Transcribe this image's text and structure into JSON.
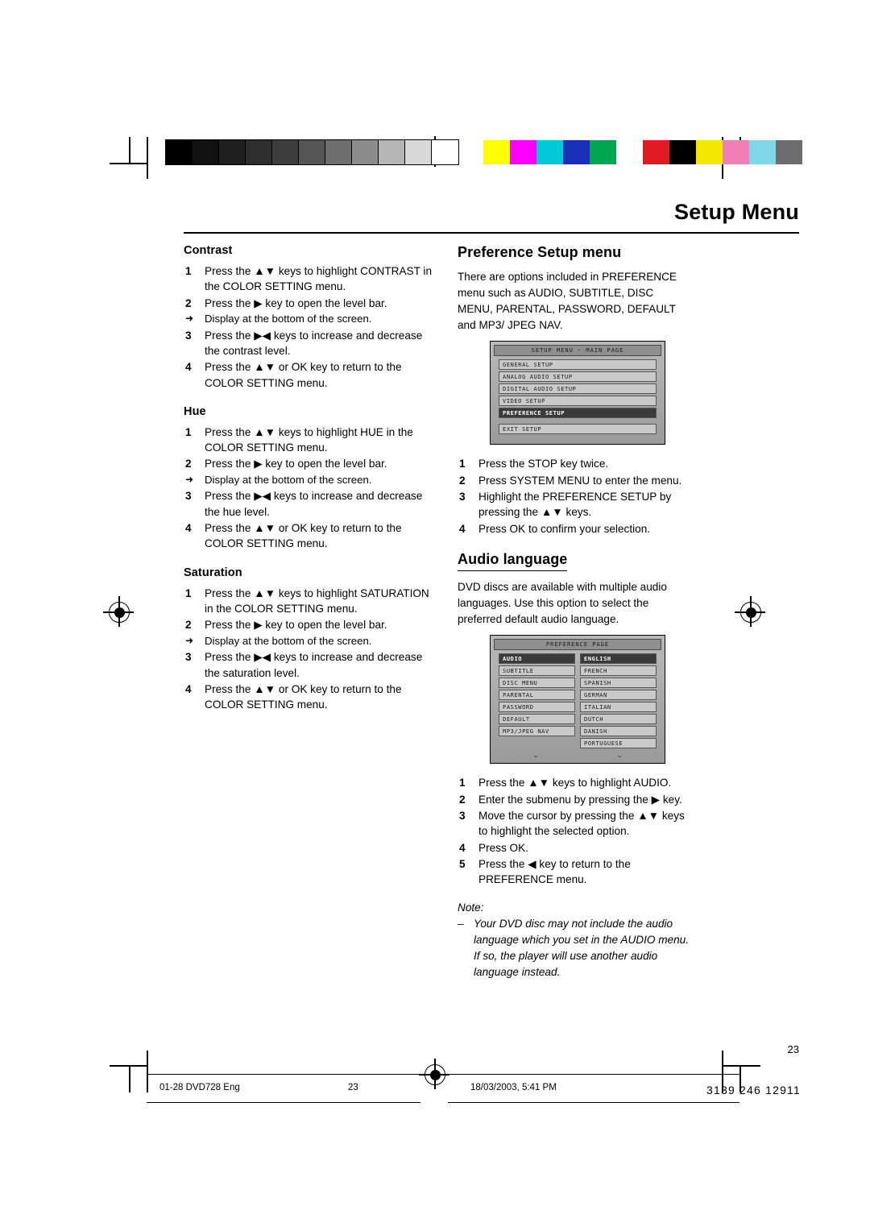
{
  "header": {
    "title": "Setup Menu"
  },
  "left_column": {
    "sections": [
      {
        "heading": "Contrast",
        "steps": [
          "Press the ▲▼ keys to highlight CONTRAST in the COLOR SETTING menu.",
          "Press the ▶ key to open the level bar.",
          "Press the ▶◀ keys to increase and decrease the contrast level.",
          "Press the ▲▼ or OK key to return to the COLOR SETTING menu."
        ],
        "note_after_step": 2,
        "note": "Display at the bottom of the screen."
      },
      {
        "heading": "Hue",
        "steps": [
          "Press the ▲▼ keys to highlight HUE in the COLOR SETTING menu.",
          "Press the ▶ key to open the level bar.",
          "Press the ▶◀ keys to increase and decrease the hue level.",
          "Press the ▲▼ or OK key to return to the COLOR SETTING menu."
        ],
        "note_after_step": 2,
        "note": "Display at the bottom of the screen."
      },
      {
        "heading": "Saturation",
        "steps": [
          "Press the ▲▼ keys to highlight SATURATION in the COLOR SETTING menu.",
          "Press the ▶ key to open the level bar.",
          "Press the ▶◀ keys to increase and decrease the saturation level.",
          "Press the ▲▼ or OK key to return to the COLOR SETTING menu."
        ],
        "note_after_step": 2,
        "note": "Display at the bottom of the screen."
      }
    ]
  },
  "right_column": {
    "preference": {
      "heading": "Preference Setup menu",
      "intro": "There are options included in PREFERENCE menu such as AUDIO, SUBTITLE, DISC MENU, PARENTAL, PASSWORD,  DEFAULT and MP3/ JPEG NAV.",
      "osd": {
        "title": "SETUP MENU - MAIN PAGE",
        "rows": [
          {
            "label": "GENERAL SETUP",
            "selected": false
          },
          {
            "label": "ANALOG AUDIO SETUP",
            "selected": false
          },
          {
            "label": "DIGITAL AUDIO SETUP",
            "selected": false
          },
          {
            "label": "VIDEO SETUP",
            "selected": false
          },
          {
            "label": "PREFERENCE SETUP",
            "selected": true
          }
        ],
        "exit": "EXIT SETUP"
      },
      "steps": [
        "Press the STOP key twice.",
        "Press SYSTEM MENU to enter the menu.",
        "Highlight the PREFERENCE SETUP by pressing the ▲▼ keys.",
        "Press OK to confirm your selection."
      ]
    },
    "audio_language": {
      "heading": "Audio language",
      "intro": "DVD discs are available with multiple audio languages. Use this option to select the preferred default audio language.",
      "osd": {
        "title": "PREFERENCE PAGE",
        "left_rows": [
          {
            "label": "AUDIO",
            "selected": true
          },
          {
            "label": "SUBTITLE",
            "selected": false
          },
          {
            "label": "DISC MENU",
            "selected": false
          },
          {
            "label": "PARENTAL",
            "selected": false
          },
          {
            "label": "PASSWORD",
            "selected": false
          },
          {
            "label": "DEFAULT",
            "selected": false
          },
          {
            "label": "MP3/JPEG NAV",
            "selected": false
          }
        ],
        "right_rows": [
          {
            "label": "ENGLISH",
            "selected": true
          },
          {
            "label": "FRENCH",
            "selected": false
          },
          {
            "label": "SPANISH",
            "selected": false
          },
          {
            "label": "GERMAN",
            "selected": false
          },
          {
            "label": "ITALIAN",
            "selected": false
          },
          {
            "label": "DUTCH",
            "selected": false
          },
          {
            "label": "DANISH",
            "selected": false
          },
          {
            "label": "PORTUGUESE",
            "selected": false
          }
        ],
        "scroll_down_icon": "⌄"
      },
      "steps": [
        "Press the ▲▼ keys to highlight AUDIO.",
        "Enter the submenu by pressing the ▶  key.",
        "Move the cursor by pressing the ▲▼ keys to highlight the selected option.",
        "Press OK.",
        "Press the ◀ key to return to the PREFERENCE menu."
      ],
      "note_label": "Note:",
      "note_text": "Your DVD disc may not include the audio language which you set in the AUDIO menu. If so, the player will use another audio language instead."
    }
  },
  "footer": {
    "file": "01-28 DVD728 Eng",
    "page_left": "23",
    "timestamp": "18/03/2003, 5:41 PM",
    "page_number": "23",
    "doc_number": "3139 246 12911"
  },
  "color_bars": {
    "grayscale": [
      "#000000",
      "#111111",
      "#1f1f1f",
      "#2e2e2e",
      "#3d3d3d",
      "#555555",
      "#6e6e6e",
      "#8c8c8c",
      "#b5b5b5",
      "#d8d8d8",
      "#ffffff"
    ],
    "chroma": [
      "#ffff00",
      "#ff00ff",
      "#00c8d8",
      "#1a2fb8",
      "#00a651",
      "#ffffff",
      "#e01b22",
      "#000000",
      "#f5e800",
      "#f07fb8",
      "#7fd8e8",
      "#6d6d6d"
    ]
  }
}
